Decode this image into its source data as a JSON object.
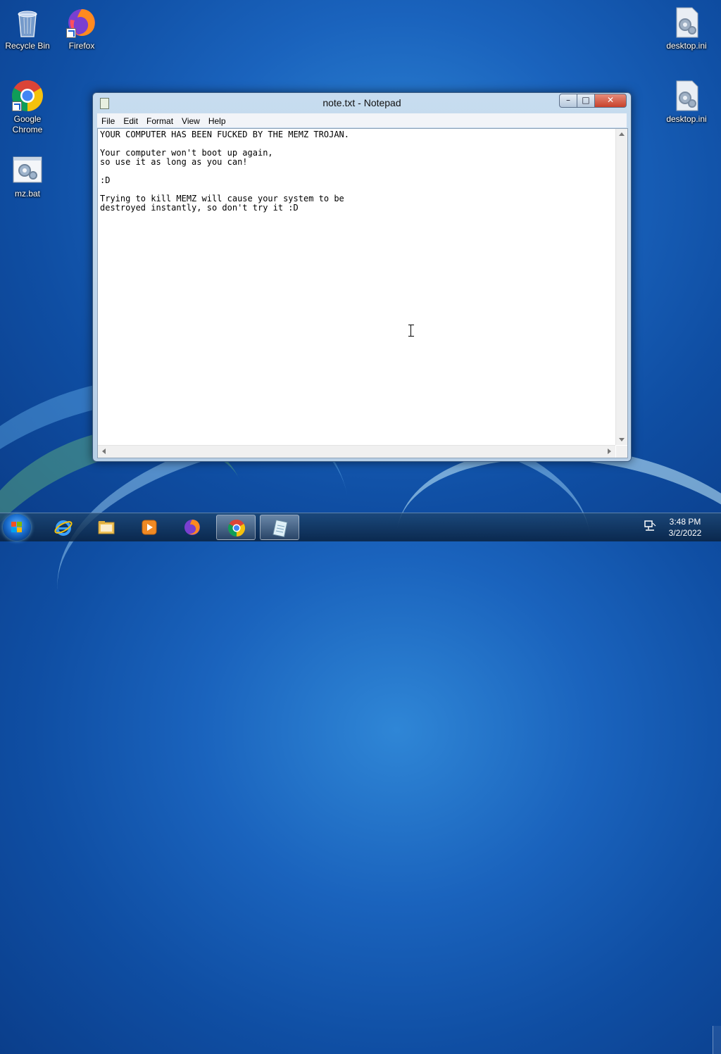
{
  "desktop": {
    "icons": [
      {
        "label": "Recycle Bin",
        "icon": "recycle-bin-icon"
      },
      {
        "label": "Firefox",
        "icon": "firefox-icon"
      },
      {
        "label": "Google Chrome",
        "icon": "chrome-icon"
      },
      {
        "label": "mz.bat",
        "icon": "batch-file-icon"
      },
      {
        "label": "desktop.ini",
        "icon": "settings-file-icon"
      },
      {
        "label": "desktop.ini",
        "icon": "settings-file-icon"
      }
    ]
  },
  "window": {
    "title": "note.txt - Notepad",
    "menu": [
      "File",
      "Edit",
      "Format",
      "View",
      "Help"
    ],
    "content": "YOUR COMPUTER HAS BEEN FUCKED BY THE MEMZ TROJAN.\n\nYour computer won't boot up again,\nso use it as long as you can!\n\n:D\n\nTrying to kill MEMZ will cause your system to be\ndestroyed instantly, so don't try it :D",
    "controls": {
      "minimize": "–",
      "maximize": "□",
      "close": "✕"
    }
  },
  "taskbar": {
    "pinned": [
      "Internet Explorer",
      "Windows Explorer",
      "Windows Media Player",
      "Firefox",
      "Google Chrome",
      "Notepad"
    ],
    "clock": {
      "time": "3:48 PM",
      "date": "3/2/2022"
    }
  },
  "colors": {
    "accent": "#1a63bd",
    "close": "#c8412b"
  }
}
